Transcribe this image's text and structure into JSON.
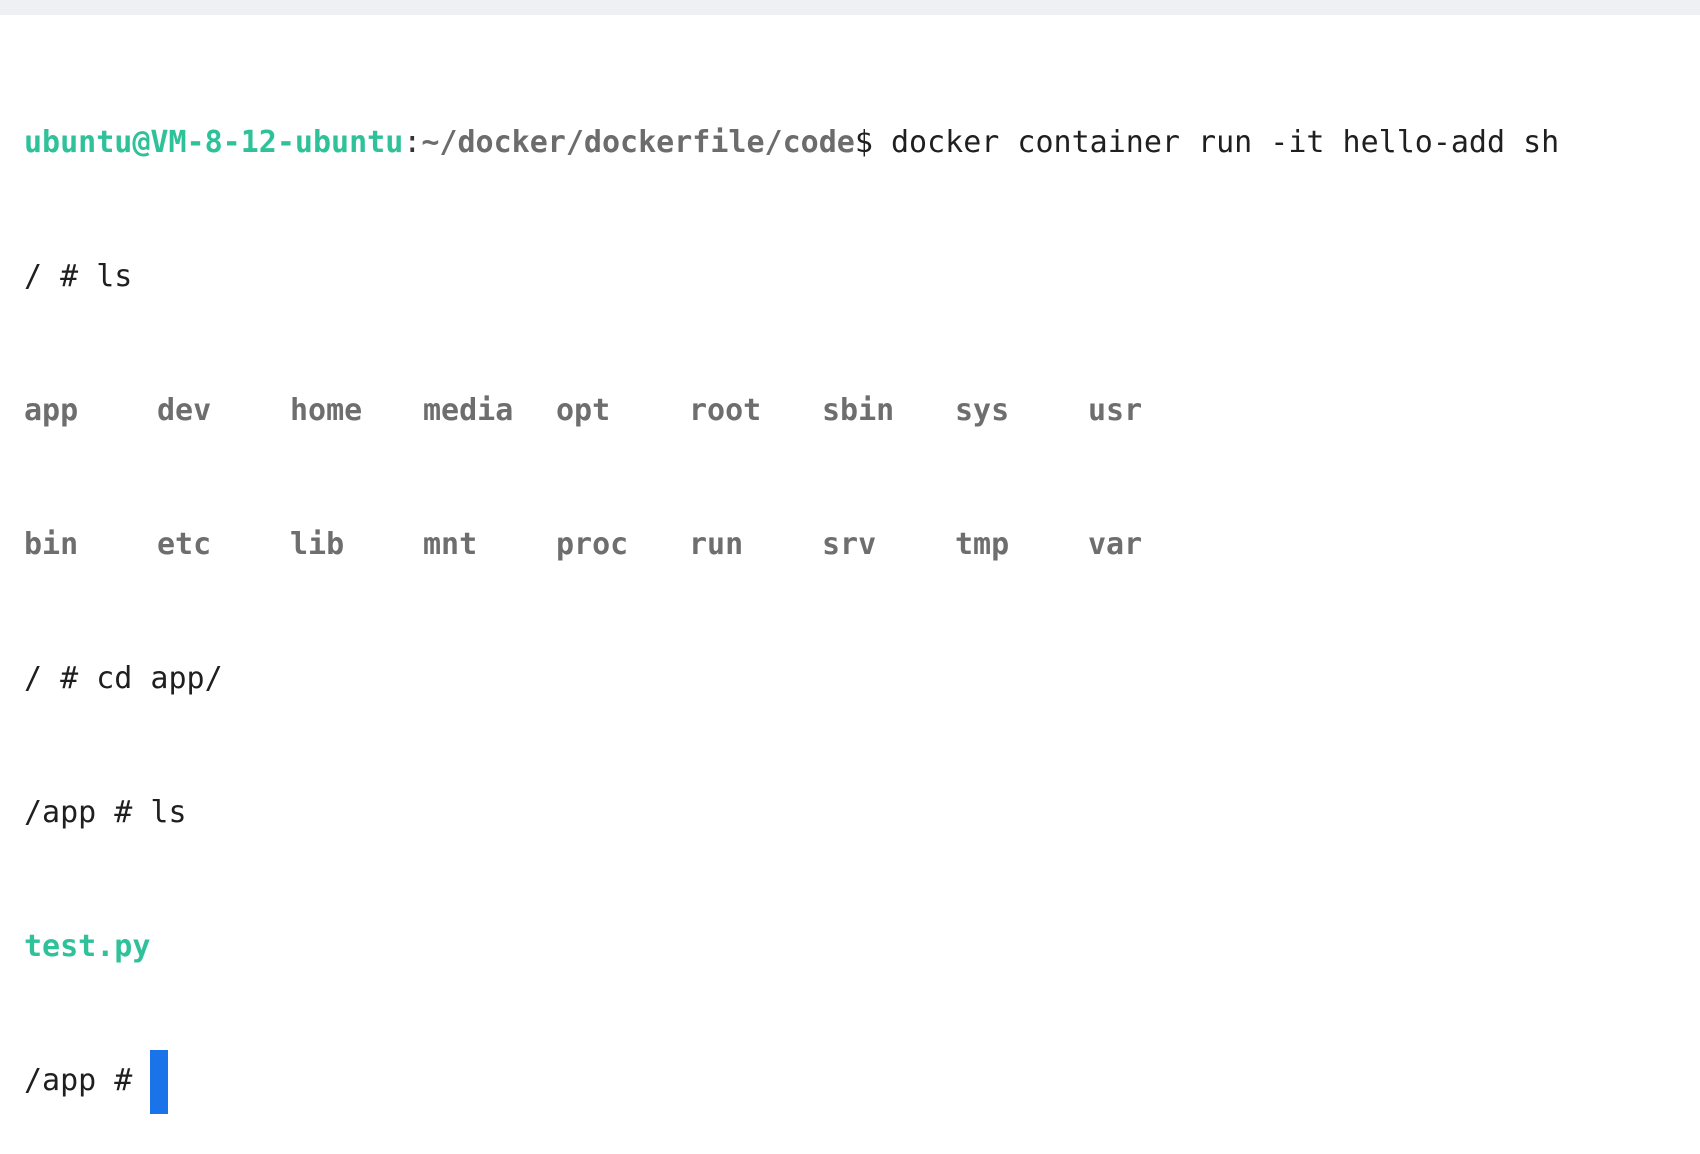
{
  "terminal": {
    "prompt_user_host": "ubuntu@VM-8-12-ubuntu",
    "prompt_colon": ":",
    "prompt_path": "~/docker/dockerfile/code",
    "prompt_dollar": "$",
    "command1": " docker container run -it hello-add sh",
    "line2": "/ # ls",
    "ls_row1": [
      "app",
      "dev",
      "home",
      "media",
      "opt",
      "root",
      "sbin",
      "sys",
      "usr"
    ],
    "ls_row2": [
      "bin",
      "etc",
      "lib",
      "mnt",
      "proc",
      "run",
      "srv",
      "tmp",
      "var"
    ],
    "line5": "/ # cd app/",
    "line6": "/app # ls",
    "file1": "test.py",
    "final_prompt": "/app # "
  },
  "colors": {
    "accent_green": "#2ec19a",
    "directory_gray": "#6e6e6e",
    "cursor_blue": "#1a73e8",
    "topbar": "#eff0f3"
  }
}
